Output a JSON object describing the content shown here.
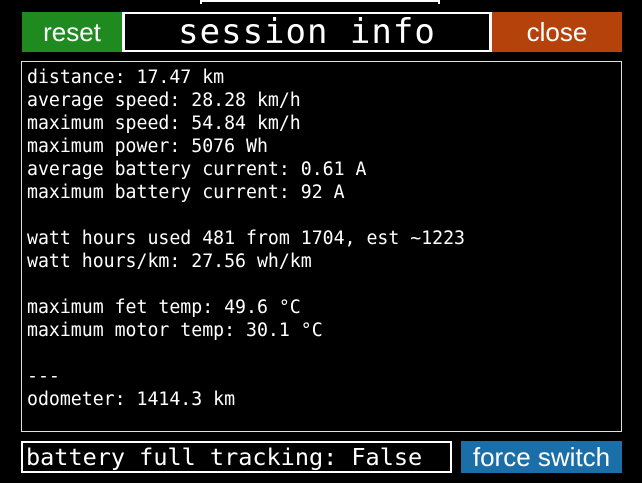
{
  "header": {
    "reset_label": "reset",
    "title": "session info",
    "close_label": "close"
  },
  "stats": {
    "distance": "distance: 17.47 km",
    "average_speed": "average speed: 28.28 km/h",
    "maximum_speed": "maximum speed: 54.84 km/h",
    "maximum_power": "maximum power: 5076 Wh",
    "average_battery_current": "average battery current: 0.61 A",
    "maximum_battery_current": "maximum battery current: 92 A",
    "watt_hours_used": "watt hours used 481 from 1704, est ~1223",
    "watt_hours_per_km": "watt hours/km: 27.56 wh/km",
    "maximum_fet_temp": "maximum fet temp: 49.6 °C",
    "maximum_motor_temp": "maximum motor temp: 30.1 °C",
    "separator": "---",
    "odometer": "odometer: 1414.3 km"
  },
  "footer": {
    "tracking_status": "battery full tracking: False",
    "force_switch_label": "force switch"
  },
  "colors": {
    "reset": "#1f8a1f",
    "close": "#b5420a",
    "force_switch": "#1a6fa8",
    "background": "#000000",
    "text": "#ffffff"
  }
}
